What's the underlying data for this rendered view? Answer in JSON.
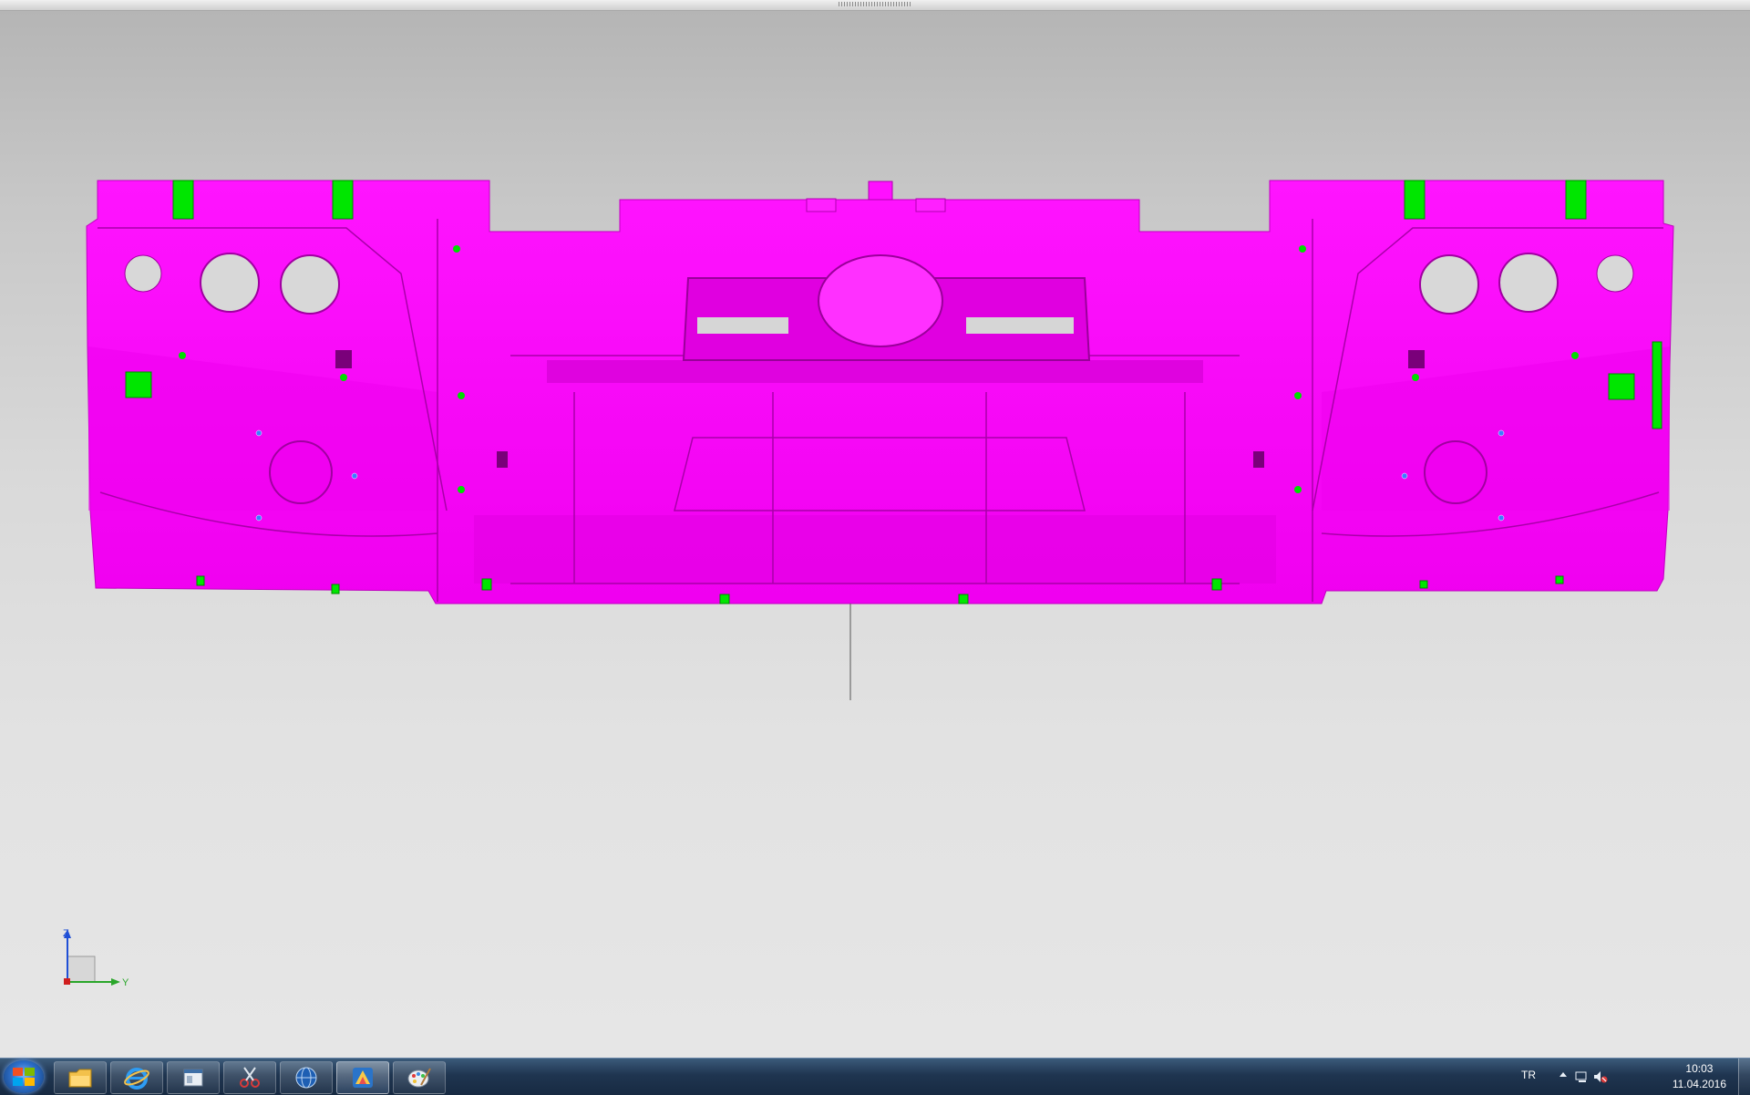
{
  "viewport": {
    "model_part_color": "#ff00ff",
    "clip_color": "#00e600",
    "background_top": "#b4b4b4",
    "background_bottom": "#e6e6e6"
  },
  "triad": {
    "z_label": "Z",
    "y_label": "Y",
    "z_color": "#1f4fd6",
    "y_color": "#2aa62a",
    "x_color": "#d01e1e"
  },
  "taskbar": {
    "start_icon": "windows-orb-icon",
    "pinned": [
      {
        "icon": "folder-icon"
      },
      {
        "icon": "internet-explorer-icon"
      },
      {
        "icon": "window-app-icon"
      },
      {
        "icon": "snipping-tool-icon"
      },
      {
        "icon": "globe-icon"
      },
      {
        "icon": "cad-app-icon"
      },
      {
        "icon": "paint-icon"
      }
    ],
    "language": "TR",
    "time": "10:03",
    "date": "11.04.2016"
  }
}
